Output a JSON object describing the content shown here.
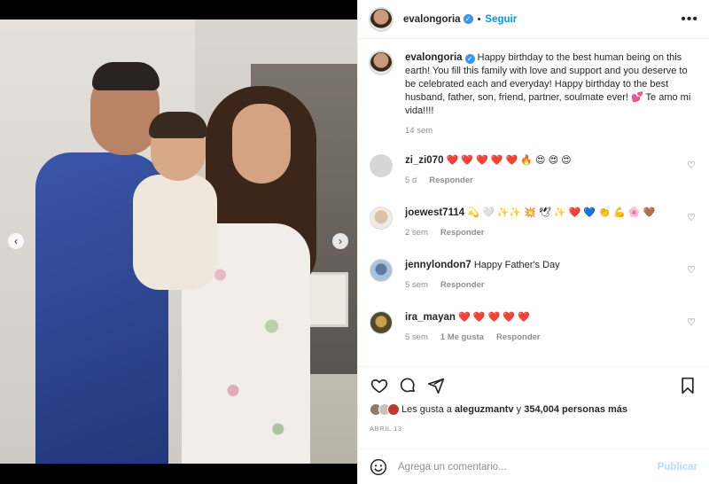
{
  "post": {
    "username": "evalongoria",
    "follow_label": "Seguir",
    "caption": "Happy birthday to the best human being on this earth! You fill this family with love and support and you deserve to be celebrated each and everyday! Happy birthday to the best husband, father, son, friend, partner, soulmate ever! 💕 Te amo mi vida!!!!",
    "caption_time": "14 sem"
  },
  "comments": [
    {
      "user": "zi_zi070",
      "text": "❤️ ❤️ ❤️ ❤️ ❤️ 🔥 😍 😍 😍",
      "time": "5 d",
      "reply": "Responder",
      "likes": ""
    },
    {
      "user": "joewest7114",
      "text": "💫 🤍 ✨✨ 💥 🕊 ✨ ❤️ 💙 👏 💪 🌸 🤎",
      "time": "2 sem",
      "reply": "Responder",
      "likes": ""
    },
    {
      "user": "jennylondon7",
      "text": "Happy Father's Day",
      "time": "5 sem",
      "reply": "Responder",
      "likes": ""
    },
    {
      "user": "ira_mayan",
      "text": "❤️ ❤️ ❤️ ❤️ ❤️",
      "time": "5 sem",
      "reply": "Responder",
      "likes": "1 Me gusta"
    }
  ],
  "likes": {
    "prefix": "Les gusta a",
    "user": "aleguzmantv",
    "connector": "y",
    "count": "354,004 personas más"
  },
  "date": "ABRIL 13",
  "composer": {
    "placeholder": "Agrega un comentario...",
    "post_label": "Publicar"
  },
  "colors": {
    "accent": "#0095f6",
    "verified": "#3897f0",
    "muted": "#8e8e8e"
  },
  "icons": [
    "more-options-icon",
    "verified-icon",
    "heart-icon",
    "comment-icon",
    "share-icon",
    "bookmark-icon",
    "emoji-icon",
    "chevron-left-icon",
    "chevron-right-icon"
  ]
}
